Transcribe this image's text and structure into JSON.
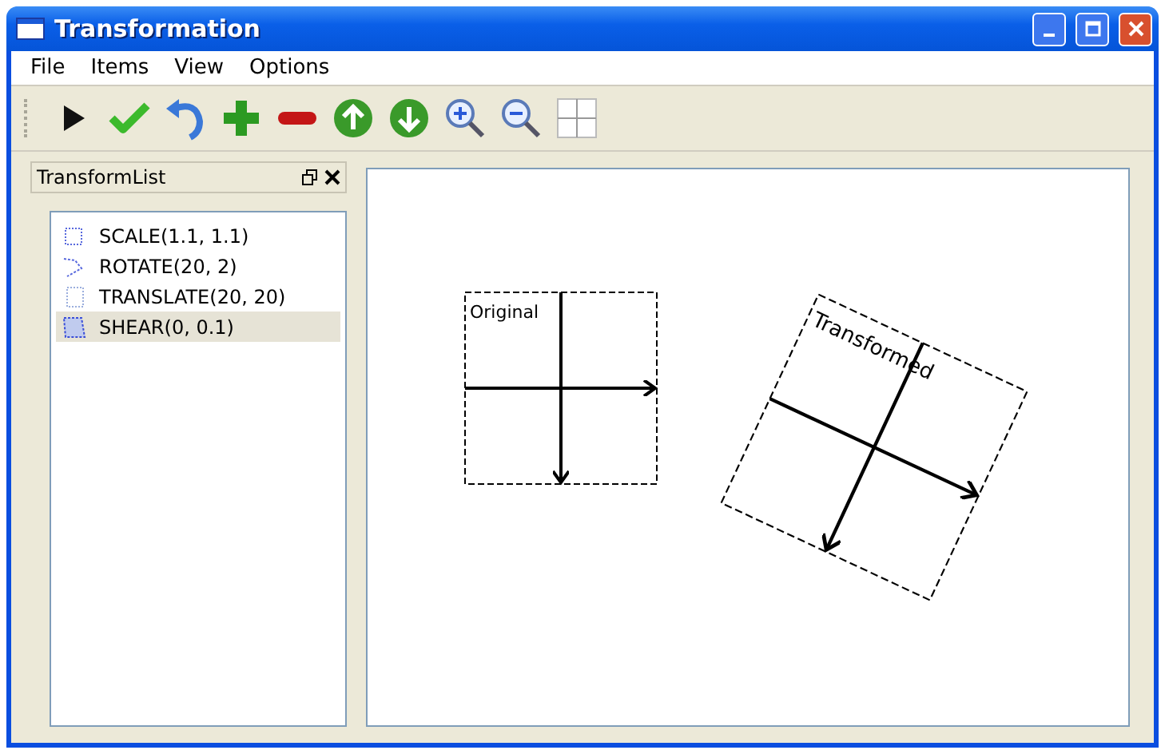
{
  "window": {
    "title": "Transformation"
  },
  "menu": [
    "File",
    "Items",
    "View",
    "Options"
  ],
  "dock": {
    "title": "TransformList",
    "items": [
      {
        "label": "SCALE(1.1, 1.1)",
        "kind": "scale",
        "selected": false
      },
      {
        "label": "ROTATE(20, 2)",
        "kind": "rotate",
        "selected": false
      },
      {
        "label": "TRANSLATE(20, 20)",
        "kind": "translate",
        "selected": false
      },
      {
        "label": "SHEAR(0, 0.1)",
        "kind": "shear",
        "selected": true
      }
    ]
  },
  "canvas": {
    "original_label": "Original",
    "transformed_label": "Transformed"
  }
}
